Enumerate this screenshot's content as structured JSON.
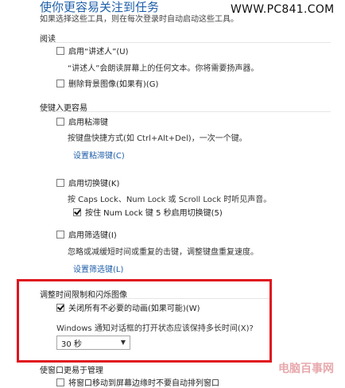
{
  "header": {
    "title": "使你更容易关注到任务",
    "subtitle": "如果选择这些工具，则在每次登录时自动启动这些工具。",
    "watermark": "WWW.PC841.COM"
  },
  "reading": {
    "heading": "阅读",
    "narrator": {
      "label": "启用“讲述人”(U)",
      "checked": false
    },
    "narrator_desc": "“讲述人”会朗读屏幕上的任何文本。你将需要扬声器。",
    "remove_bg": {
      "label": "删除背景图像(如果有)(G)",
      "checked": false
    }
  },
  "keyboard": {
    "heading": "使键入更容易",
    "sticky": {
      "label": "启用粘滞键",
      "checked": false
    },
    "sticky_desc": "按键盘快捷方式(如 Ctrl+Alt+Del)，一次一个键。",
    "sticky_link": "设置粘滞键(C)",
    "toggle": {
      "label": "启用切换键(K)",
      "checked": false
    },
    "toggle_desc": "按 Caps Lock、Num Lock 或 Scroll Lock 时听见声音。",
    "toggle_hold": {
      "label": "按住 Num Lock 键 5 秒启用切换键(5)",
      "checked": true
    },
    "filter": {
      "label": "启用筛选键(I)",
      "checked": false
    },
    "filter_desc": "忽略或减缓短时间或重复的击键，调整键盘重复速度。",
    "filter_link": "设置筛选键(L)"
  },
  "timing": {
    "heading": "调整时间限制和闪烁图像",
    "disable_anim": {
      "label": "关闭所有不必要的动画(如果可能)(W)",
      "checked": true
    },
    "notify_question": "Windows 通知对话框的打开状态应该保持多长时间(X)?",
    "notify_select_value": "30 秒"
  },
  "window_mgmt": {
    "heading": "使窗口更易于管理",
    "prevent_arrange": {
      "label": "将窗口移动到屏幕边缘时不要自动排列窗口",
      "checked": false
    }
  },
  "footer_logo": "电脑百事网"
}
